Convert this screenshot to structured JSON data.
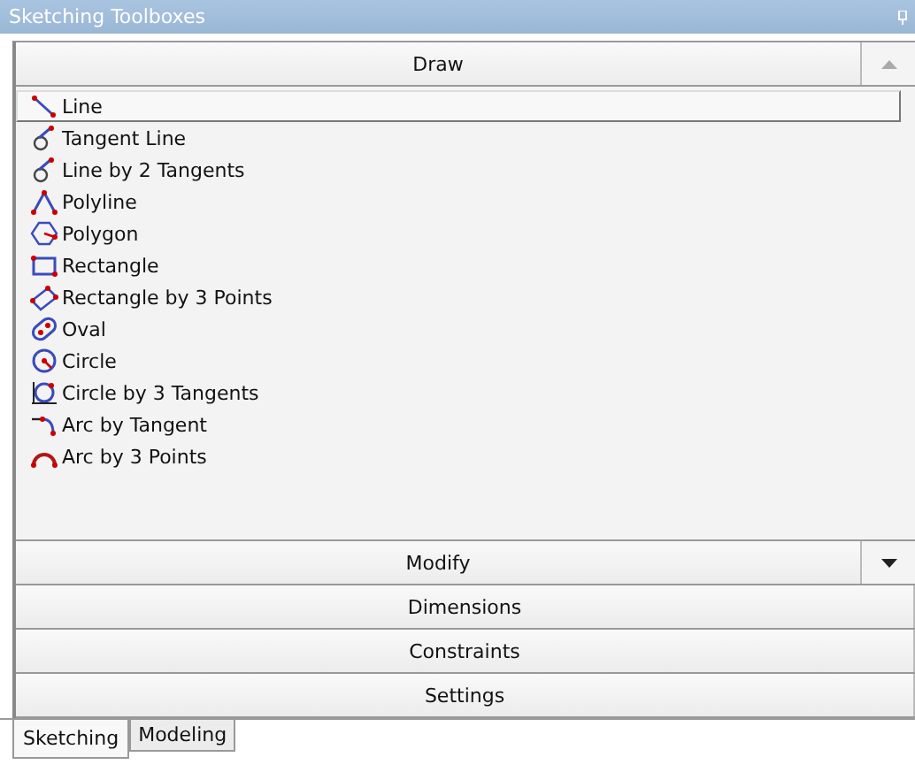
{
  "window": {
    "title": "Sketching Toolboxes"
  },
  "sections": [
    {
      "title": "Draw",
      "tools": [
        {
          "label": "Line",
          "kind": "line",
          "selected": true
        },
        {
          "label": "Tangent Line",
          "kind": "tangent",
          "selected": false
        },
        {
          "label": "Line by 2 Tangents",
          "kind": "tangent",
          "selected": false
        },
        {
          "label": "Polyline",
          "kind": "polyline",
          "selected": false
        },
        {
          "label": "Polygon",
          "kind": "polygon",
          "selected": false
        },
        {
          "label": "Rectangle",
          "kind": "rectangle",
          "selected": false
        },
        {
          "label": "Rectangle by 3 Points",
          "kind": "rect3",
          "selected": false
        },
        {
          "label": "Oval",
          "kind": "oval",
          "selected": false
        },
        {
          "label": "Circle",
          "kind": "circle",
          "selected": false
        },
        {
          "label": "Circle by 3 Tangents",
          "kind": "circle3",
          "selected": false
        },
        {
          "label": "Arc by Tangent",
          "kind": "arctan",
          "selected": false
        },
        {
          "label": "Arc by 3 Points",
          "kind": "arc3",
          "selected": false
        }
      ]
    },
    {
      "title": "Modify"
    },
    {
      "title": "Dimensions"
    },
    {
      "title": "Constraints"
    },
    {
      "title": "Settings"
    }
  ],
  "tabs": [
    {
      "label": "Sketching",
      "selected": true
    },
    {
      "label": "Modeling",
      "selected": false
    }
  ]
}
